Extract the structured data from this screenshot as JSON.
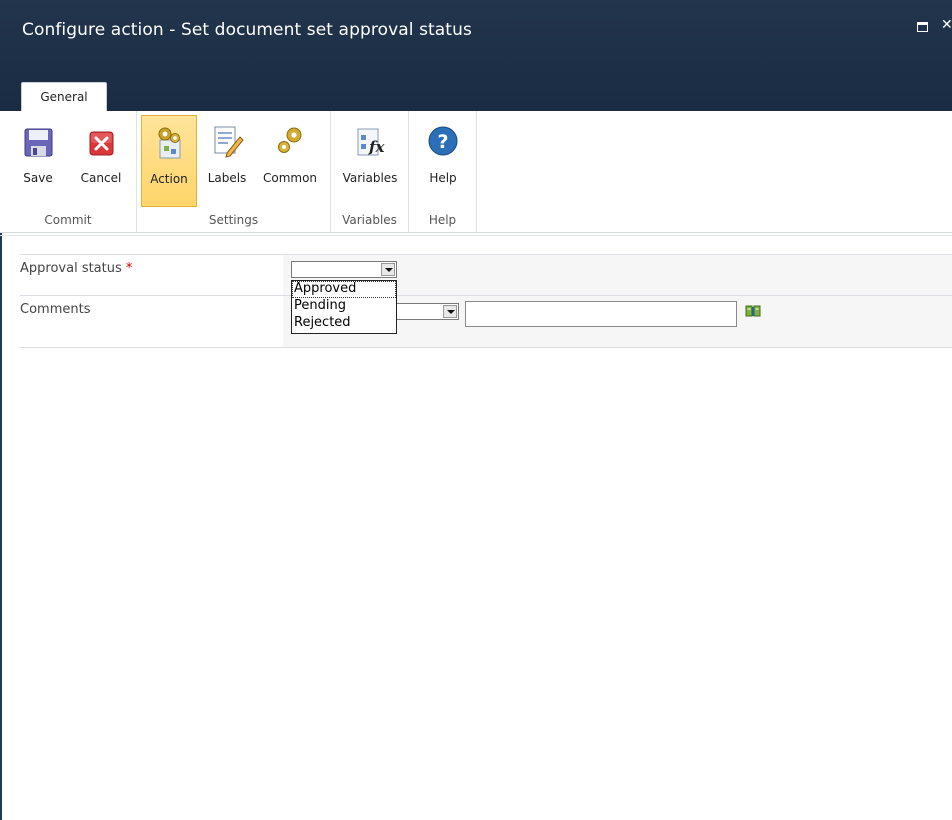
{
  "window": {
    "title": "Configure action - Set document set approval status",
    "maximize_label": "",
    "close_label": "✕"
  },
  "tabs": [
    {
      "label": "General",
      "active": true
    }
  ],
  "ribbon": {
    "groups": [
      {
        "name": "Commit",
        "buttons": [
          {
            "label": "Save",
            "icon": "save-icon"
          },
          {
            "label": "Cancel",
            "icon": "cancel-icon"
          }
        ]
      },
      {
        "name": "Settings",
        "buttons": [
          {
            "label": "Action",
            "icon": "action-gears-icon",
            "active": true
          },
          {
            "label": "Labels",
            "icon": "labels-icon"
          },
          {
            "label": "Common",
            "icon": "common-gears-icon"
          }
        ]
      },
      {
        "name": "Variables",
        "buttons": [
          {
            "label": "Variables",
            "icon": "fx-variables-icon"
          }
        ]
      },
      {
        "name": "Help",
        "buttons": [
          {
            "label": "Help",
            "icon": "help-icon"
          }
        ]
      }
    ]
  },
  "form": {
    "approval_status": {
      "label": "Approval status",
      "required_mark": "*",
      "value": "",
      "options": [
        "Approved",
        "Pending",
        "Rejected"
      ],
      "highlighted_option": "Approved"
    },
    "comments": {
      "label": "Comments",
      "select_value": "",
      "text_value": ""
    }
  },
  "colors": {
    "titlebar": "#1c2f47",
    "active_button": "#ffd56b",
    "required": "#cc0000"
  }
}
